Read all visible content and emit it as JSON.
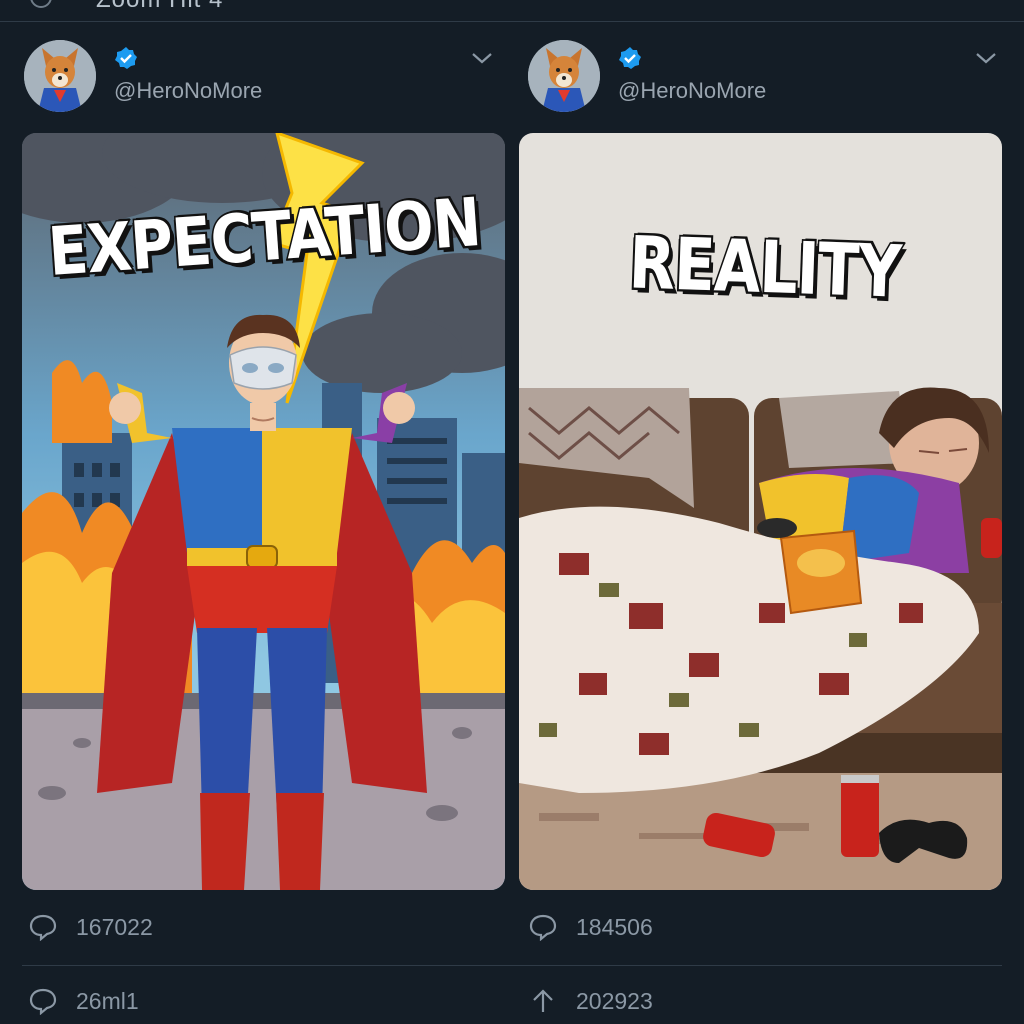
{
  "topbar": {
    "title": "Zoom Hit 4"
  },
  "posts": [
    {
      "handle": "@HeroNoMore",
      "verified": true,
      "avatar_icon": "fox-hero-avatar",
      "image_caption": "EXPECTATION",
      "stats": {
        "replies": "167022",
        "secondary": "26ml1"
      }
    },
    {
      "handle": "@HeroNoMore",
      "verified": true,
      "avatar_icon": "fox-hero-avatar",
      "image_caption": "REALITY",
      "stats": {
        "replies": "184506",
        "shares": "202923"
      }
    }
  ],
  "colors": {
    "background": "#141d26",
    "verified": "#1d9bf0",
    "text_muted": "#8b98a5"
  }
}
